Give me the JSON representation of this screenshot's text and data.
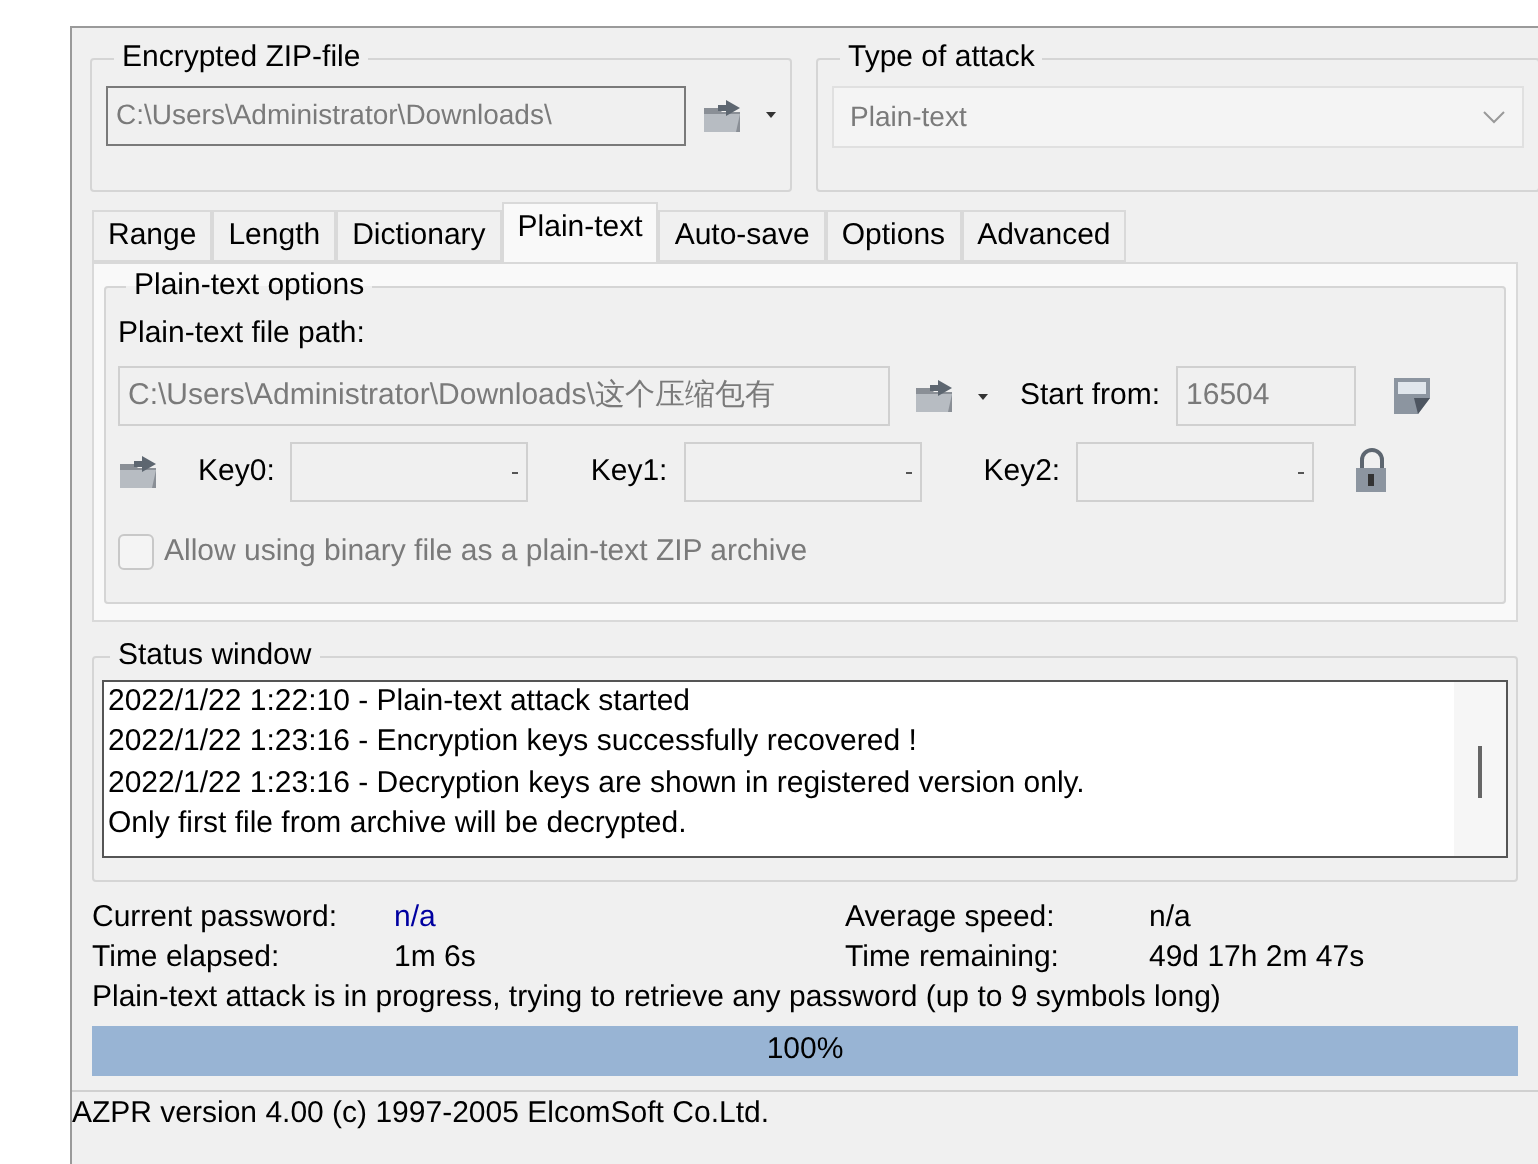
{
  "zip_file": {
    "label": "Encrypted ZIP-file",
    "path": "C:\\Users\\Administrator\\Downloads\\",
    "disabled": true
  },
  "attack_type": {
    "label": "Type of attack",
    "value": "Plain-text",
    "disabled": true
  },
  "tabs": [
    {
      "label": "Range",
      "selected": false
    },
    {
      "label": "Length",
      "selected": false
    },
    {
      "label": "Dictionary",
      "selected": false
    },
    {
      "label": "Plain-text",
      "selected": true
    },
    {
      "label": "Auto-save",
      "selected": false
    },
    {
      "label": "Options",
      "selected": false
    },
    {
      "label": "Advanced",
      "selected": false
    }
  ],
  "plain_text": {
    "group_label": "Plain-text options",
    "file_path_label": "Plain-text file path:",
    "file_path": "C:\\Users\\Administrator\\Downloads\\这个压缩包有",
    "start_from_label": "Start from:",
    "start_from": "16504",
    "keys": [
      {
        "label": "Key0:"
      },
      {
        "label": "Key1:"
      },
      {
        "label": "Key2:"
      }
    ],
    "binary_option": {
      "label": "Allow using binary file as a plain-text ZIP archive",
      "checked": false,
      "disabled": true
    }
  },
  "status_window": {
    "label": "Status window",
    "lines": [
      "2022/1/22 1:22:10 - Plain-text attack started",
      "2022/1/22 1:23:16 - Encryption keys successfully recovered !",
      "2022/1/22 1:23:16 - Decryption keys are shown in registered version only.",
      "Only first file from archive will be decrypted."
    ]
  },
  "info": [
    {
      "label": "Current password:",
      "value": "n/a",
      "highlight": true
    },
    {
      "label": "Average speed:",
      "value": "n/a",
      "highlight": false
    },
    {
      "label": "Time elapsed:",
      "value": "1m 6s",
      "highlight": false
    },
    {
      "label": "Time remaining:",
      "value": "49d 17h 2m 47s",
      "highlight": false
    }
  ],
  "message": "Plain-text attack is in progress, trying to retrieve any password (up to 9 symbols long)",
  "progress": {
    "level": 1,
    "text": "100%"
  },
  "status_bar": "AZPR version 4.00 (c) 1997-2005 ElcomSoft Co.Ltd."
}
